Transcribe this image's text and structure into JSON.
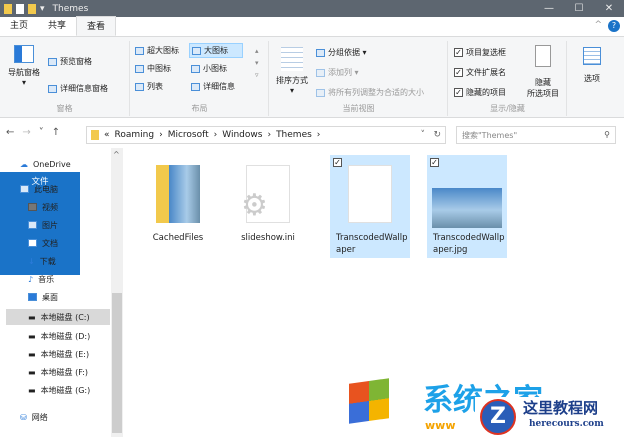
{
  "window": {
    "title": "Themes",
    "min": "—",
    "max": "☐",
    "close": "✕"
  },
  "tabs": [
    "文件",
    "主页",
    "共享",
    "查看"
  ],
  "ribbon": {
    "pane": {
      "nav": "导航窗格",
      "preview": "预览窗格",
      "details": "详细信息窗格",
      "label": "窗格"
    },
    "layout": {
      "items": [
        "超大图标",
        "大图标",
        "中图标",
        "小图标",
        "列表",
        "详细信息"
      ],
      "label": "布局"
    },
    "view": {
      "sort": "排序方式",
      "group": "分组依据 ▾",
      "addcol": "添加列 ▾",
      "fit": "将所有列调整为合适的大小",
      "label": "当前视图"
    },
    "show": {
      "checkboxes": "项目复选框",
      "ext": "文件扩展名",
      "hidden": "隐藏的项目",
      "hide": "隐藏",
      "hide2": "所选项目",
      "label": "显示/隐藏"
    },
    "options": "选项"
  },
  "address": {
    "back": "←",
    "fwd": "→",
    "recent": "˅",
    "up": "↑",
    "crumbs": [
      "«",
      "Roaming",
      "›",
      "Microsoft",
      "›",
      "Windows",
      "›",
      "Themes",
      "›"
    ],
    "search_placeholder": "搜索\"Themes\""
  },
  "sidebar": [
    "OneDrive",
    "此电脑",
    "视频",
    "图片",
    "文档",
    "下载",
    "音乐",
    "桌面",
    "本地磁盘 (C:)",
    "本地磁盘 (D:)",
    "本地磁盘 (E:)",
    "本地磁盘 (F:)",
    "本地磁盘 (G:)",
    "网络"
  ],
  "files": [
    {
      "name": "CachedFiles",
      "selected": false
    },
    {
      "name": "slideshow.ini",
      "selected": false
    },
    {
      "name": "TranscodedWallpaper",
      "selected": true
    },
    {
      "name": "TranscodedWallpaper.jpg",
      "selected": true
    }
  ],
  "watermark": {
    "brand": "系统之家",
    "site_cn": "这里教程网",
    "site": "herecours.com",
    "www": "www"
  }
}
